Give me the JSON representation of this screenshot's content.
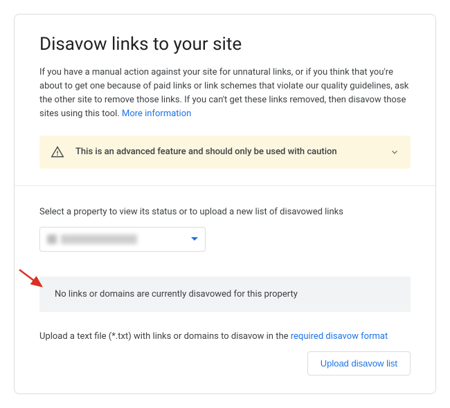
{
  "header": {
    "title": "Disavow links to your site",
    "description": "If you have a manual action against your site for unnatural links, or if you think that you're about to get one because of paid links or link schemes that violate our quality guidelines, ask the other site to remove those links. If you can't get these links removed, then disavow those sites using this tool. ",
    "more_info": "More information"
  },
  "alert": {
    "text": "This is an advanced feature and should only be used with caution"
  },
  "property": {
    "label": "Select a property to view its status or to upload a new list of disavowed links"
  },
  "status": {
    "message": "No links or domains are currently disavowed for this property"
  },
  "upload": {
    "prefix": "Upload a text file (*.txt) with links or domains to disavow in the ",
    "link": "required disavow format",
    "button": "Upload disavow list"
  }
}
